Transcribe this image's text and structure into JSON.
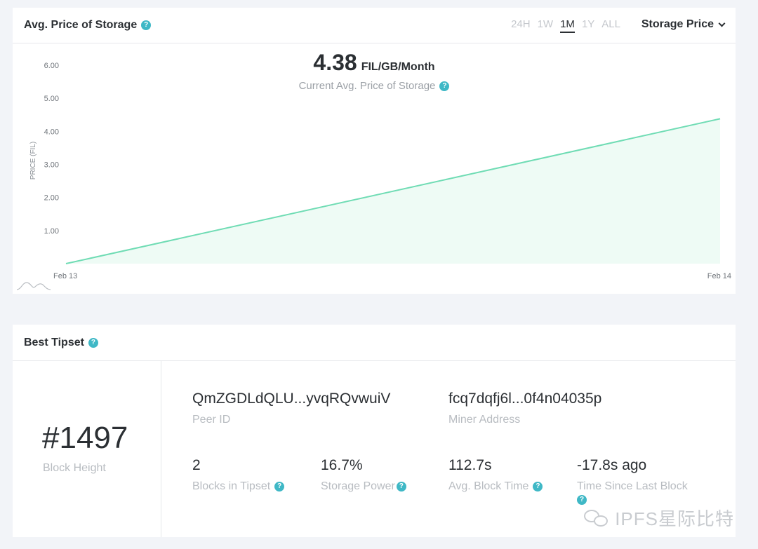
{
  "price_card": {
    "title": "Avg. Price of Storage",
    "ranges": [
      "24H",
      "1W",
      "1M",
      "1Y",
      "ALL"
    ],
    "active_range": "1M",
    "metric_select": "Storage Price",
    "hero_value": "4.38",
    "hero_unit": "FIL/GB/Month",
    "hero_caption": "Current Avg. Price of Storage"
  },
  "chart_data": {
    "type": "area",
    "x": [
      "Feb 13",
      "Feb 14"
    ],
    "values": [
      0.0,
      4.38
    ],
    "ylabel": "PRICE (FIL)",
    "y_ticks": [
      "1.00",
      "2.00",
      "3.00",
      "4.00",
      "5.00",
      "6.00"
    ],
    "ylim": [
      0,
      6
    ],
    "line_color": "#6fdcb4",
    "fill_color": "#eefbf5"
  },
  "tipset_card": {
    "title": "Best Tipset",
    "block_height": "#1497",
    "block_height_label": "Block Height",
    "peer_id": "QmZGDLdQLU...yvqRQvwuiV",
    "peer_id_label": "Peer ID",
    "miner_address": "fcq7dqfj6l...0f4n04035p",
    "miner_address_label": "Miner Address",
    "blocks_in_tipset": "2",
    "blocks_in_tipset_label": "Blocks in Tipset",
    "storage_power": "16.7%",
    "storage_power_label": "Storage Power",
    "avg_block_time": "112.7s",
    "avg_block_time_label": "Avg. Block Time",
    "time_since_last_block": "-17.8s ago",
    "time_since_last_block_label": "Time Since Last Block"
  },
  "watermark": "IPFS星际比特",
  "colors": {
    "accent": "#3fb8c6",
    "text": "#2b2f33",
    "muted": "#b8bcc1"
  }
}
